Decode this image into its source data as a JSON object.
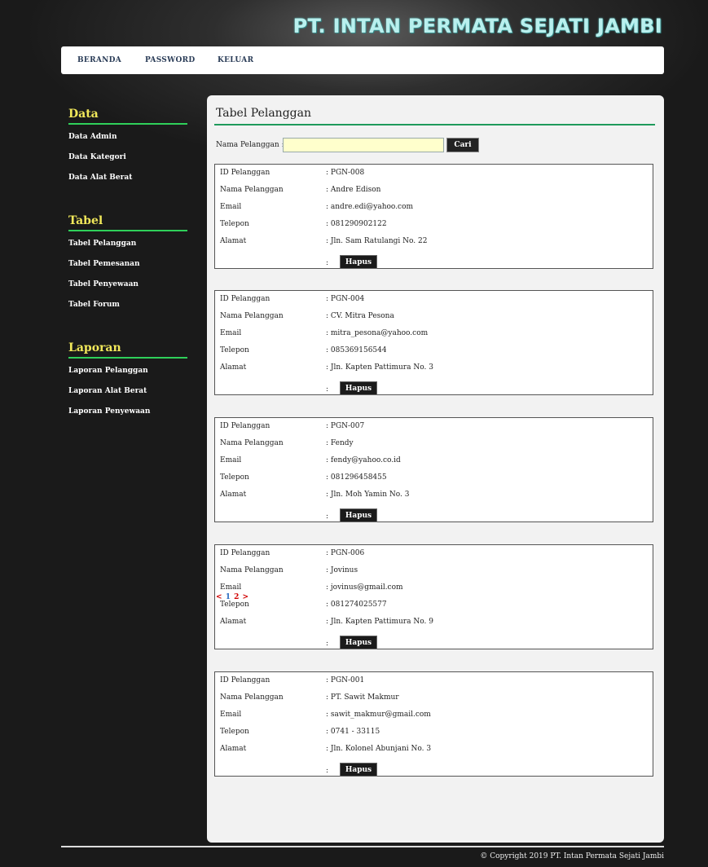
{
  "site": {
    "title": "PT. INTAN PERMATA SEJATI JAMBI"
  },
  "nav": [
    {
      "label": "BERANDA"
    },
    {
      "label": "PASSWORD"
    },
    {
      "label": "KELUAR"
    }
  ],
  "sidebar": {
    "groups": [
      {
        "heading": "Data",
        "items": [
          {
            "label": "Data Admin"
          },
          {
            "label": "Data Kategori"
          },
          {
            "label": "Data Alat Berat"
          }
        ]
      },
      {
        "heading": "Tabel",
        "items": [
          {
            "label": "Tabel Pelanggan"
          },
          {
            "label": "Tabel Pemesanan"
          },
          {
            "label": "Tabel Penyewaan"
          },
          {
            "label": "Tabel Forum"
          }
        ]
      },
      {
        "heading": "Laporan",
        "items": [
          {
            "label": "Laporan Pelanggan"
          },
          {
            "label": "Laporan Alat Berat"
          },
          {
            "label": "Laporan Penyewaan"
          }
        ]
      }
    ]
  },
  "main": {
    "title": "Tabel Pelanggan",
    "search": {
      "label": "Nama Pelanggan :",
      "value": "",
      "button": "Cari"
    },
    "field_labels": {
      "id": "ID Pelanggan",
      "nama": "Nama Pelanggan",
      "email": "Email",
      "telepon": "Telepon",
      "alamat": "Alamat"
    },
    "colon": ":",
    "delete_label": "Hapus",
    "customers": [
      {
        "id": ": PGN-008",
        "nama": ": Andre Edison",
        "email": ": andre.edi@yahoo.com",
        "telepon": ": 081290902122",
        "alamat": ": Jln. Sam Ratulangi No. 22"
      },
      {
        "id": ": PGN-004",
        "nama": ": CV. Mitra Pesona",
        "email": ": mitra_pesona@yahoo.com",
        "telepon": ": 085369156544",
        "alamat": ": Jln. Kapten Pattimura No. 3"
      },
      {
        "id": ": PGN-007",
        "nama": ": Fendy",
        "email": ": fendy@yahoo.co.id",
        "telepon": ": 081296458455",
        "alamat": ": Jln. Moh Yamin No. 3"
      },
      {
        "id": ": PGN-006",
        "nama": ": Jovinus",
        "email": ": jovinus@gmail.com",
        "telepon": ": 081274025577",
        "alamat": ": Jln. Kapten Pattimura No. 9"
      },
      {
        "id": ": PGN-001",
        "nama": ": PT. Sawit Makmur",
        "email": ": sawit_makmur@gmail.com",
        "telepon": ": 0741 - 33115",
        "alamat": ": Jln. Kolonel Abunjani No. 3"
      }
    ],
    "pagination": {
      "prev": "<",
      "current": "1",
      "next_page": "2",
      "next": ">"
    }
  },
  "footer": {
    "copyright": "© Copyright 2019 PT. Intan Permata Sejati Jambi"
  },
  "colors": {
    "site_title": "#b9f0ee",
    "sidebar_heading": "#f1e85a",
    "sidebar_rule": "#2fd05a",
    "title_rule": "#1f9a5c",
    "search_input_bg": "#ffffcc",
    "pager_link": "#d10000",
    "pager_current": "#2a6cc2"
  }
}
